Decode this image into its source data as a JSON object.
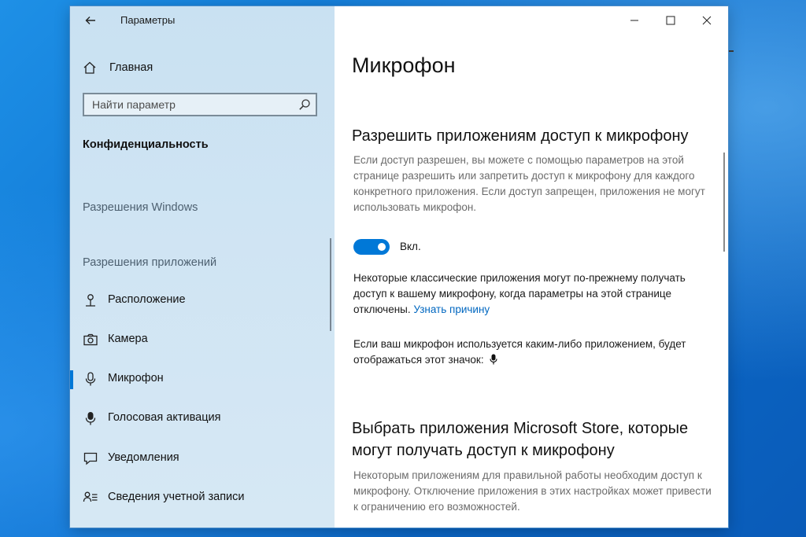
{
  "window": {
    "title": "Параметры",
    "controls": {
      "minimize": "–",
      "maximize": "□",
      "close": "✕"
    }
  },
  "sidebar": {
    "home_label": "Главная",
    "search": {
      "placeholder": "Найти параметр",
      "value": ""
    },
    "section_title": "Конфиденциальность",
    "group_windows": "Разрешения Windows",
    "group_apps": "Разрешения приложений",
    "items": [
      {
        "label": "Расположение",
        "icon": "location-icon"
      },
      {
        "label": "Камера",
        "icon": "camera-icon"
      },
      {
        "label": "Микрофон",
        "icon": "microphone-icon",
        "active": true
      },
      {
        "label": "Голосовая активация",
        "icon": "voice-activation-icon"
      },
      {
        "label": "Уведомления",
        "icon": "notifications-icon"
      },
      {
        "label": "Сведения учетной записи",
        "icon": "account-info-icon"
      }
    ]
  },
  "content": {
    "page_title": "Микрофон",
    "allow_heading": "Разрешить приложениям доступ к микрофону",
    "allow_desc": "Если доступ разрешен, вы можете с помощью параметров на этой странице разрешить или запретить доступ к микрофону для каждого конкретного приложения. Если доступ запрещен, приложения не могут использовать микрофон.",
    "toggle": {
      "state": true,
      "label": "Вкл."
    },
    "classic_text": "Некоторые классические приложения могут по-прежнему получать доступ к вашему микрофону, когда параметры на этой странице отключены.",
    "classic_link": "Узнать причину",
    "indicator_text": "Если ваш микрофон используется каким-либо приложением, будет отображаться этот значок:",
    "store_heading": "Выбрать приложения Microsoft Store, которые могут получать доступ к микрофону",
    "store_desc": "Некоторым приложениям для правильной работы необходим доступ к микрофону. Отключение приложения в этих настройках может привести к ограничению его возможностей."
  },
  "colors": {
    "accent": "#0078d7",
    "link": "#0067c0",
    "sidebar_bg": "#cfe4f3",
    "desktop": "#0b6fcf"
  }
}
